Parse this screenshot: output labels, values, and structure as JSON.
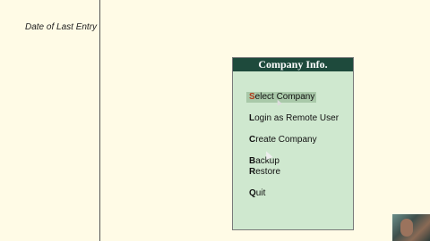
{
  "left_panel": {
    "label": "Date of Last Entry"
  },
  "menu": {
    "title": "Company Info.",
    "items": [
      {
        "hot": "S",
        "rest": "elect Company",
        "selected": true
      },
      {
        "hot": "L",
        "rest": "ogin as Remote User"
      },
      {
        "hot": "C",
        "rest": "reate Company"
      },
      {
        "hot": "B",
        "rest": "ackup"
      },
      {
        "hot": "R",
        "rest": "estore"
      },
      {
        "hot": "Q",
        "rest": "uit"
      }
    ]
  },
  "colors": {
    "background": "#fffbe6",
    "panel_bg": "#cfe8cf",
    "title_bg": "#1e4a3c",
    "highlight_bg": "#a9c9a9",
    "hotkey_selected": "#b33a1a"
  },
  "icons": {
    "pointer": "mouse-pointer-icon"
  }
}
